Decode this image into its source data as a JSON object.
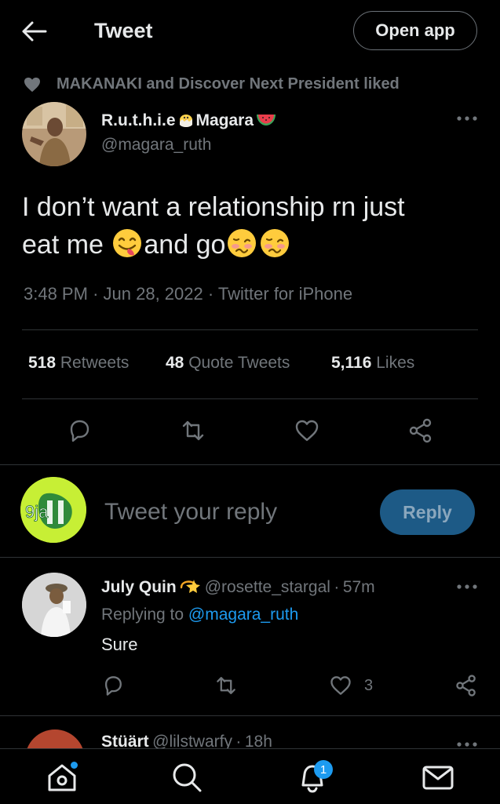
{
  "header": {
    "title": "Tweet",
    "open_app_label": "Open app"
  },
  "social_context": {
    "text": "MAKANAKI and Discover Next President liked"
  },
  "tweet": {
    "author_name_part1": "R.u.t.h.i.e",
    "author_name_part2": "Magara",
    "handle": "@magara_ruth",
    "text_line1": "I don’t want a relationship rn just",
    "text_line2_a": "eat me ",
    "text_line2_b": "and go",
    "time": "3:48 PM",
    "date": "Jun 28, 2022",
    "source": "Twitter for iPhone",
    "stats": {
      "retweets_count": "518",
      "retweets_label": "Retweets",
      "quotes_count": "48",
      "quotes_label": "Quote Tweets",
      "likes_count": "5,116",
      "likes_label": "Likes"
    }
  },
  "reply_composer": {
    "placeholder": "Tweet your reply",
    "button_label": "Reply",
    "avatar_text": "9ja"
  },
  "replies": [
    {
      "name": "July Quin",
      "handle": "@rosette_stargal",
      "time": "57m",
      "replying_prefix": "Replying to",
      "replying_to": "@magara_ruth",
      "text": "Sure",
      "likes": "3"
    },
    {
      "name": "Stüärt",
      "handle": "@lilstwarfy",
      "time": "18h"
    }
  ],
  "separator": "·",
  "colors": {
    "accent": "#1d9bf0",
    "muted": "#71767b",
    "text": "#e7e9ea",
    "divider": "#2f3336"
  },
  "nav": {
    "notifications_badge": "1"
  }
}
